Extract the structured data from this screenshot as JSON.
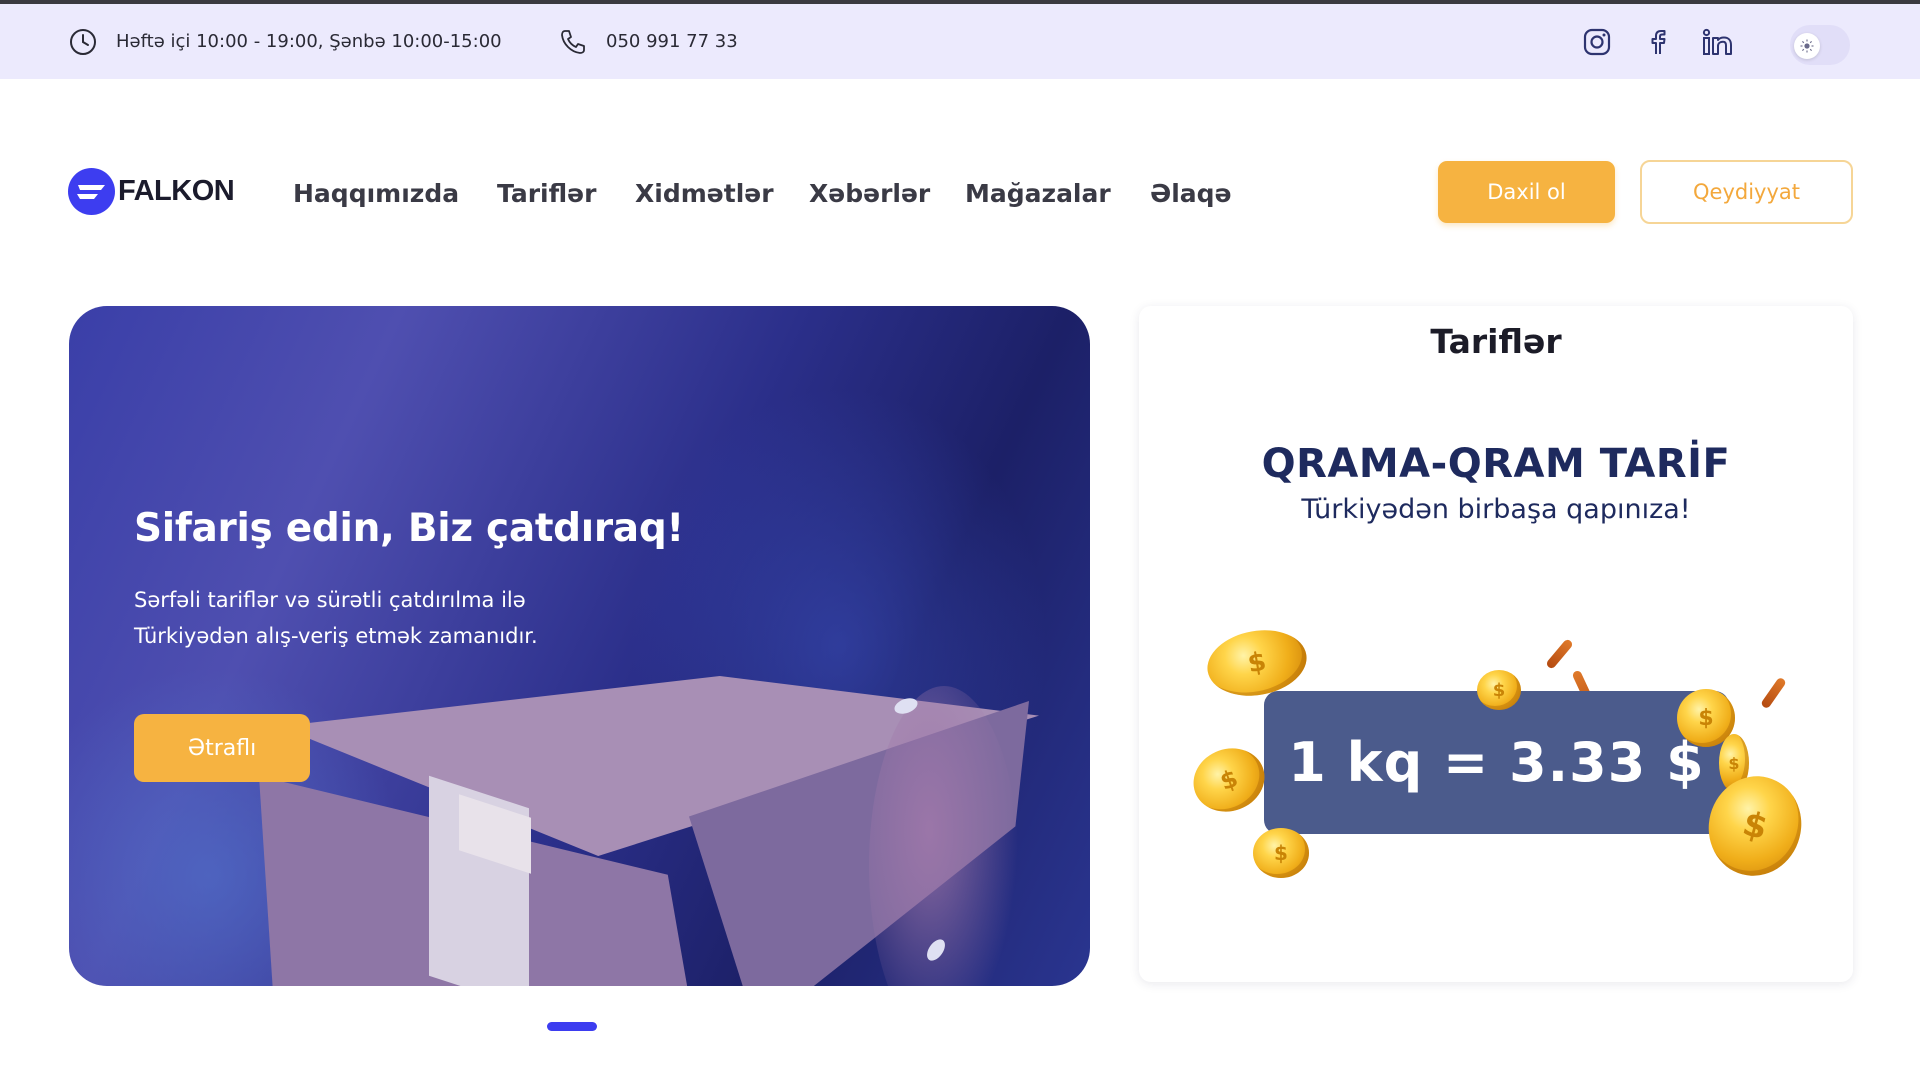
{
  "topbar": {
    "hours": "Həftə içi 10:00 - 19:00, Şənbə 10:00-15:00",
    "phone": "050 991 77 33"
  },
  "brand": {
    "name": "FALKON"
  },
  "nav": {
    "items": [
      "Haqqımızda",
      "Tariflər",
      "Xidmətlər",
      "Xəbərlər",
      "Mağazalar",
      "Əlaqə"
    ]
  },
  "auth": {
    "login": "Daxil ol",
    "register": "Qeydiyyat"
  },
  "hero": {
    "title": "Sifariş edin, Biz çatdıraq!",
    "subtitle_line1": "Sərfəli tariflər və sürətli çatdırılma ilə",
    "subtitle_line2": "Türkiyədən alış-veriş etmək zamanıdır.",
    "button": "Ətraflı"
  },
  "tariffs": {
    "title": "Tariflər",
    "promo_title": "QRAMA-QRAM TARİF",
    "promo_subtitle": "Türkiyədən birbaşa qapınıza!",
    "price": "1 kq = 3.33 $"
  },
  "colors": {
    "accent": "#f6b341",
    "brand": "#3d3df0",
    "topbar_bg": "#eceafd",
    "navy": "#1e2a5e"
  },
  "icons": [
    "clock-icon",
    "phone-icon",
    "instagram-icon",
    "facebook-icon",
    "linkedin-icon",
    "sun-icon"
  ]
}
